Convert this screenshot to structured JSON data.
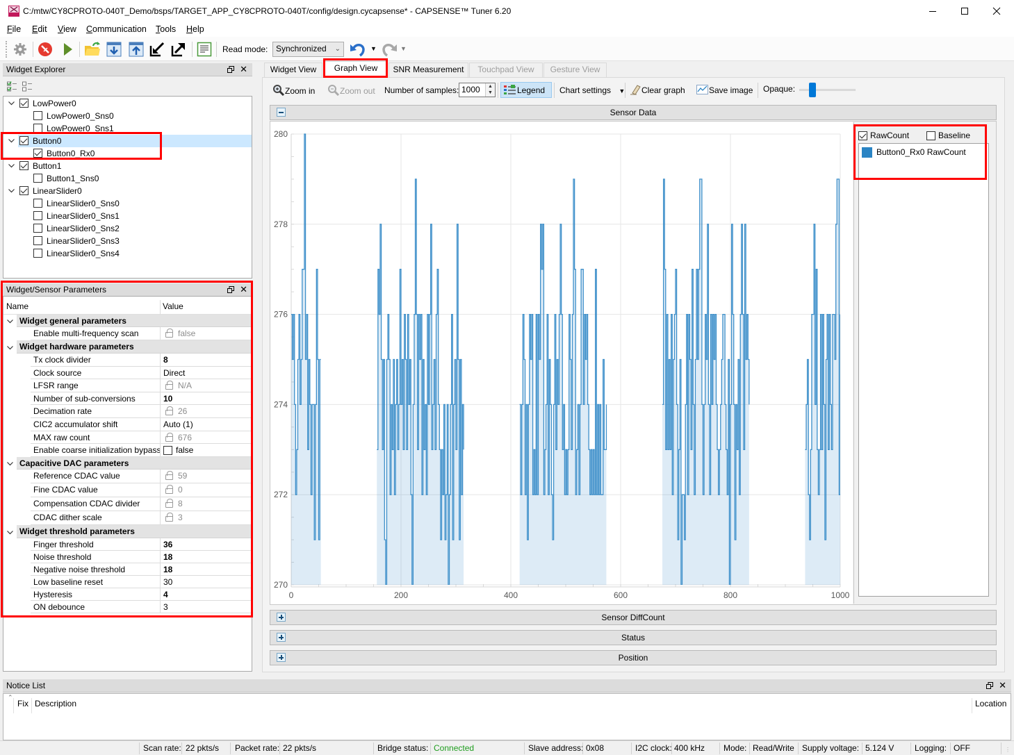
{
  "window": {
    "title": "C:/mtw/CY8CPROTO-040T_Demo/bsps/TARGET_APP_CY8CPROTO-040T/config/design.cycapsense* - CAPSENSE™ Tuner 6.20",
    "app_icon": "capsense-tuner-icon"
  },
  "menu": {
    "items": [
      "File",
      "Edit",
      "View",
      "Communication",
      "Tools",
      "Help"
    ]
  },
  "toolbar": {
    "icons": [
      "gear-icon",
      "stop-icon",
      "play-icon",
      "open-folder-icon",
      "read-from-device-icon",
      "write-to-device-icon",
      "import-icon",
      "export-icon",
      "log-icon",
      "undo-icon",
      "redo-icon"
    ],
    "read_mode_label": "Read mode:",
    "read_mode_value": "Synchronized"
  },
  "widget_explorer": {
    "title": "Widget Explorer",
    "tree": [
      {
        "label": "LowPower0",
        "checked": true,
        "level": 0
      },
      {
        "label": "LowPower0_Sns0",
        "checked": false,
        "level": 1
      },
      {
        "label": "LowPower0_Sns1",
        "checked": false,
        "level": 1
      },
      {
        "label": "Button0",
        "checked": true,
        "level": 0,
        "selected": true
      },
      {
        "label": "Button0_Rx0",
        "checked": true,
        "level": 1
      },
      {
        "label": "Button1",
        "checked": true,
        "level": 0
      },
      {
        "label": "Button1_Sns0",
        "checked": false,
        "level": 1
      },
      {
        "label": "LinearSlider0",
        "checked": true,
        "level": 0
      },
      {
        "label": "LinearSlider0_Sns0",
        "checked": false,
        "level": 1
      },
      {
        "label": "LinearSlider0_Sns1",
        "checked": false,
        "level": 1
      },
      {
        "label": "LinearSlider0_Sns2",
        "checked": false,
        "level": 1
      },
      {
        "label": "LinearSlider0_Sns3",
        "checked": false,
        "level": 1
      },
      {
        "label": "LinearSlider0_Sns4",
        "checked": false,
        "level": 1
      }
    ]
  },
  "parameters": {
    "title": "Widget/Sensor Parameters",
    "columns": [
      "Name",
      "Value"
    ],
    "groups": [
      {
        "label": "Widget general parameters",
        "rows": [
          {
            "name": "Enable multi-frequency scan",
            "value": "false",
            "locked": true
          }
        ]
      },
      {
        "label": "Widget hardware parameters",
        "rows": [
          {
            "name": "Tx clock divider",
            "value": "8",
            "bold": true
          },
          {
            "name": "Clock source",
            "value": "Direct"
          },
          {
            "name": "LFSR range",
            "value": "N/A",
            "locked": true
          },
          {
            "name": "Number of sub-conversions",
            "value": "10",
            "bold": true
          },
          {
            "name": "Decimation rate",
            "value": "26",
            "locked": true
          },
          {
            "name": "CIC2 accumulator shift",
            "value": "Auto (1)"
          },
          {
            "name": "MAX raw count",
            "value": "676",
            "locked": true
          },
          {
            "name": "Enable coarse initialization bypass",
            "value": "false",
            "checkbox": true,
            "checked": false
          }
        ]
      },
      {
        "label": "Capacitive DAC parameters",
        "rows": [
          {
            "name": "Reference CDAC value",
            "value": "59",
            "locked": true
          },
          {
            "name": "Fine CDAC value",
            "value": "0",
            "locked": true
          },
          {
            "name": "Compensation CDAC divider",
            "value": "8",
            "locked": true
          },
          {
            "name": "CDAC dither scale",
            "value": "3",
            "locked": true
          }
        ]
      },
      {
        "label": "Widget threshold parameters",
        "rows": [
          {
            "name": "Finger threshold",
            "value": "36",
            "bold": true
          },
          {
            "name": "Noise threshold",
            "value": "18",
            "bold": true
          },
          {
            "name": "Negative noise threshold",
            "value": "18",
            "bold": true
          },
          {
            "name": "Low baseline reset",
            "value": "30"
          },
          {
            "name": "Hysteresis",
            "value": "4",
            "bold": true
          },
          {
            "name": "ON debounce",
            "value": "3"
          }
        ]
      }
    ]
  },
  "tabs": {
    "items": [
      {
        "label": "Widget View",
        "enabled": true
      },
      {
        "label": "Graph View",
        "enabled": true,
        "selected": true
      },
      {
        "label": "SNR Measurement",
        "enabled": true
      },
      {
        "label": "Touchpad View",
        "enabled": false
      },
      {
        "label": "Gesture View",
        "enabled": false
      }
    ]
  },
  "graph_toolbar": {
    "zoom_in": "Zoom in",
    "zoom_out": "Zoom out",
    "samples_label": "Number of samples:",
    "samples_value": "1000",
    "legend": "Legend",
    "legend_active": true,
    "chart_settings": "Chart settings",
    "clear_graph": "Clear graph",
    "save_image": "Save image",
    "opaque_label": "Opaque:",
    "opaque_value_percent": 20
  },
  "sensor_data": {
    "title": "Sensor Data",
    "legend": {
      "rawcount_label": "RawCount",
      "rawcount_checked": true,
      "baseline_label": "Baseline",
      "baseline_checked": false,
      "items": [
        {
          "label": "Button0_Rx0 RawCount",
          "color": "#2a84c4"
        }
      ]
    }
  },
  "sections": [
    {
      "title": "Sensor DiffCount",
      "expanded": false
    },
    {
      "title": "Status",
      "expanded": false
    },
    {
      "title": "Position",
      "expanded": false
    }
  ],
  "notice_list": {
    "title": "Notice List",
    "columns": [
      "Fix",
      "Description",
      "Location"
    ]
  },
  "status_bar": {
    "scan_rate": {
      "label": "Scan rate:",
      "value": "22 pkts/s"
    },
    "packet_rate": {
      "label": "Packet rate:",
      "value": "22 pkts/s"
    },
    "bridge_status": {
      "label": "Bridge status:",
      "value": "Connected"
    },
    "slave_address": {
      "label": "Slave address:",
      "value": "0x08"
    },
    "i2c_clock": {
      "label": "I2C clock:",
      "value": "400 kHz"
    },
    "mode": {
      "label": "Mode:",
      "value": "Read/Write"
    },
    "supply_voltage": {
      "label": "Supply voltage:",
      "value": "5.124 V"
    },
    "logging": {
      "label": "Logging:",
      "value": "OFF"
    }
  },
  "colors": {
    "accent": "#0078d7",
    "series": "#2a84c4",
    "highlight": "#ff0000",
    "connected": "#1f9d1f",
    "selection": "#cce8ff"
  },
  "chart_data": {
    "type": "area",
    "title": "Sensor Data",
    "xlabel": "",
    "ylabel": "",
    "xlim": [
      0,
      1000
    ],
    "ylim": [
      270,
      280
    ],
    "x_ticks": [
      0,
      200,
      400,
      600,
      800,
      1000
    ],
    "y_ticks": [
      270,
      272,
      274,
      276,
      278,
      280
    ],
    "x_minor_step": 50,
    "y_minor_step": 0.5,
    "grid": true,
    "legend": "right",
    "line_shape": "step",
    "series": [
      {
        "name": "Button0_Rx0 RawCount",
        "color": "#2a84c4",
        "x_step": 2,
        "values_outside_segments": "below y-range (not drawn)",
        "segments": [
          {
            "x_start": 0,
            "values": [
              276,
              275,
              276,
              274,
              272,
              273,
              275,
              276,
              274,
              275,
              277,
              277,
              280,
              275,
              276,
              273,
              275,
              274,
              272,
              274,
              274,
              271,
              274,
              277,
              275,
              271,
              275,
              275
            ]
          },
          {
            "x_start": 156,
            "values": [
              273,
              277,
              276,
              278,
              275,
              273,
              275,
              271,
              270,
              275,
              276,
              275,
              272,
              274,
              273,
              275,
              272,
              274,
              275,
              273,
              274,
              277,
              274,
              275,
              273,
              276,
              275,
              273,
              276,
              274,
              275,
              272,
              270,
              274,
              276,
              279,
              276,
              273,
              276,
              275,
              276,
              272,
              275,
              273,
              274,
              272,
              276,
              274,
              276,
              278,
              273,
              274,
              275,
              273,
              276,
              277,
              274,
              273,
              271,
              273,
              272,
              274,
              271,
              272,
              274,
              270,
              272,
              274,
              276,
              271,
              274,
              275,
              273,
              278,
              275,
              271,
              275,
              272,
              274,
              273
            ]
          },
          {
            "x_start": 416,
            "values": [
              274,
              272,
              274,
              276,
              275,
              272,
              274,
              271,
              274,
              276,
              275,
              276,
              272,
              273,
              272,
              276,
              272,
              276,
              275,
              278,
              277,
              278,
              272,
              273,
              274,
              276,
              272,
              275,
              274,
              272,
              271,
              274,
              276,
              273,
              275,
              274,
              276,
              278,
              276,
              273,
              274,
              272,
              273,
              272,
              273,
              276,
              275,
              273,
              276,
              279,
              277,
              272,
              273,
              274,
              272,
              274,
              277,
              277,
              274,
              276,
              275,
              276,
              274,
              273,
              272,
              273,
              272,
              273,
              272,
              277,
              272,
              274,
              272,
              274,
              272,
              272,
              275,
              273,
              273,
              274
            ]
          },
          {
            "x_start": 676,
            "values": [
              274,
              279,
              277,
              273,
              276,
              273,
              275,
              273,
              276,
              272,
              275,
              276,
              277,
              274,
              271,
              273,
              275,
              270,
              272,
              272,
              271,
              274,
              276,
              272,
              276,
              275,
              273,
              277,
              274,
              272,
              275,
              277,
              275,
              277,
              279,
              279,
              274,
              272,
              274,
              276,
              275,
              278,
              274,
              272,
              276,
              274,
              276,
              275,
              276,
              274,
              273,
              272,
              273,
              274,
              275,
              276,
              276,
              274,
              273,
              272,
              275,
              270,
              274,
              278,
              276,
              274,
              271,
              274,
              273,
              275,
              272,
              276,
              278,
              276,
              273,
              278,
              275,
              276,
              275,
              274
            ]
          },
          {
            "x_start": 936,
            "values": [
              273,
              274,
              275,
              272,
              271,
              273,
              276,
              276,
              278,
              274,
              277,
              273,
              272,
              273,
              276,
              273,
              276,
              274,
              271,
              275,
              276,
              273,
              276,
              274,
              273,
              276,
              276,
              275,
              278,
              279,
              279,
              272,
              276
            ]
          }
        ]
      }
    ]
  }
}
